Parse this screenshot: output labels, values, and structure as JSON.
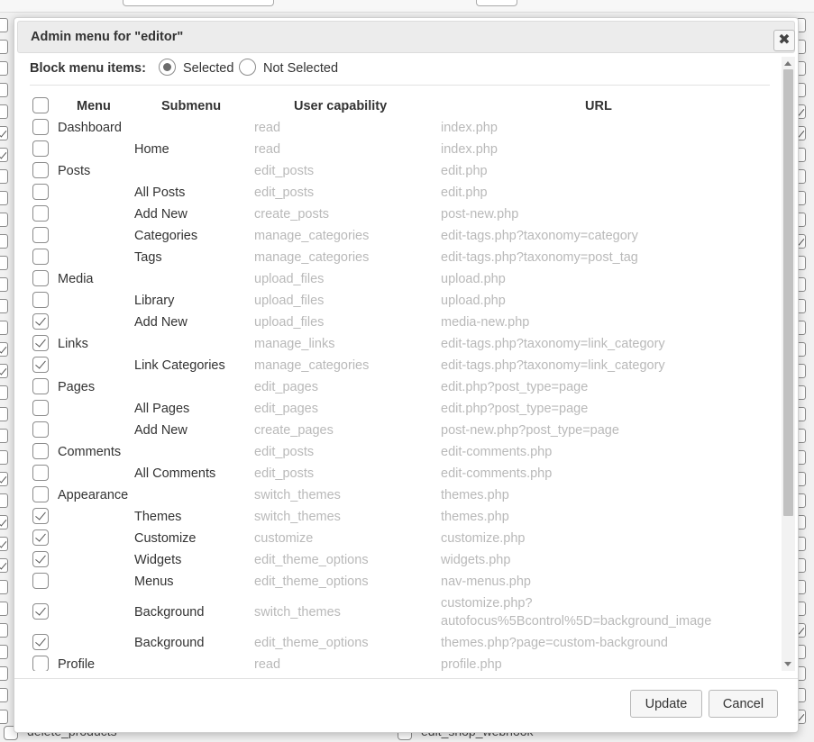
{
  "dialog": {
    "title": "Admin menu for \"editor\"",
    "close_label": "✖",
    "block_label": "Block menu items:",
    "radio_selected": "Selected",
    "radio_not_selected": "Not Selected",
    "selected_mode": "Selected"
  },
  "table": {
    "headers": {
      "menu": "Menu",
      "submenu": "Submenu",
      "capability": "User capability",
      "url": "URL"
    },
    "rows": [
      {
        "menu": "Dashboard",
        "submenu": "",
        "capability": "read",
        "url": "index.php",
        "checked": false
      },
      {
        "menu": "",
        "submenu": "Home",
        "capability": "read",
        "url": "index.php",
        "checked": false
      },
      {
        "menu": "Posts",
        "submenu": "",
        "capability": "edit_posts",
        "url": "edit.php",
        "checked": false
      },
      {
        "menu": "",
        "submenu": "All Posts",
        "capability": "edit_posts",
        "url": "edit.php",
        "checked": false
      },
      {
        "menu": "",
        "submenu": "Add New",
        "capability": "create_posts",
        "url": "post-new.php",
        "checked": false
      },
      {
        "menu": "",
        "submenu": "Categories",
        "capability": "manage_categories",
        "url": "edit-tags.php?taxonomy=category",
        "checked": false
      },
      {
        "menu": "",
        "submenu": "Tags",
        "capability": "manage_categories",
        "url": "edit-tags.php?taxonomy=post_tag",
        "checked": false
      },
      {
        "menu": "Media",
        "submenu": "",
        "capability": "upload_files",
        "url": "upload.php",
        "checked": false
      },
      {
        "menu": "",
        "submenu": "Library",
        "capability": "upload_files",
        "url": "upload.php",
        "checked": false
      },
      {
        "menu": "",
        "submenu": "Add New",
        "capability": "upload_files",
        "url": "media-new.php",
        "checked": true
      },
      {
        "menu": "Links",
        "submenu": "",
        "capability": "manage_links",
        "url": "edit-tags.php?taxonomy=link_category",
        "checked": true
      },
      {
        "menu": "",
        "submenu": "Link Categories",
        "capability": "manage_categories",
        "url": "edit-tags.php?taxonomy=link_category",
        "checked": true
      },
      {
        "menu": "Pages",
        "submenu": "",
        "capability": "edit_pages",
        "url": "edit.php?post_type=page",
        "checked": false
      },
      {
        "menu": "",
        "submenu": "All Pages",
        "capability": "edit_pages",
        "url": "edit.php?post_type=page",
        "checked": false
      },
      {
        "menu": "",
        "submenu": "Add New",
        "capability": "create_pages",
        "url": "post-new.php?post_type=page",
        "checked": false
      },
      {
        "menu": "Comments",
        "submenu": "",
        "capability": "edit_posts",
        "url": "edit-comments.php",
        "checked": false
      },
      {
        "menu": "",
        "submenu": "All Comments",
        "capability": "edit_posts",
        "url": "edit-comments.php",
        "checked": false
      },
      {
        "menu": "Appearance",
        "submenu": "",
        "capability": "switch_themes",
        "url": "themes.php",
        "checked": false
      },
      {
        "menu": "",
        "submenu": "Themes",
        "capability": "switch_themes",
        "url": "themes.php",
        "checked": true
      },
      {
        "menu": "",
        "submenu": "Customize",
        "capability": "customize",
        "url": "customize.php",
        "checked": true
      },
      {
        "menu": "",
        "submenu": "Widgets",
        "capability": "edit_theme_options",
        "url": "widgets.php",
        "checked": true
      },
      {
        "menu": "",
        "submenu": "Menus",
        "capability": "edit_theme_options",
        "url": "nav-menus.php",
        "checked": false
      },
      {
        "menu": "",
        "submenu": "Background",
        "capability": "switch_themes",
        "url": "customize.php?",
        "url2": "autofocus%5Bcontrol%5D=background_image",
        "checked": true
      },
      {
        "menu": "",
        "submenu": "Background",
        "capability": "edit_theme_options",
        "url": "themes.php?page=custom-background",
        "checked": true
      },
      {
        "menu": "Profile",
        "submenu": "",
        "capability": "read",
        "url": "profile.php",
        "checked": false
      }
    ]
  },
  "footer": {
    "update_label": "Update",
    "cancel_label": "Cancel"
  },
  "background": {
    "left_text": "delete_products",
    "right_text": "edit_shop_webhook"
  }
}
